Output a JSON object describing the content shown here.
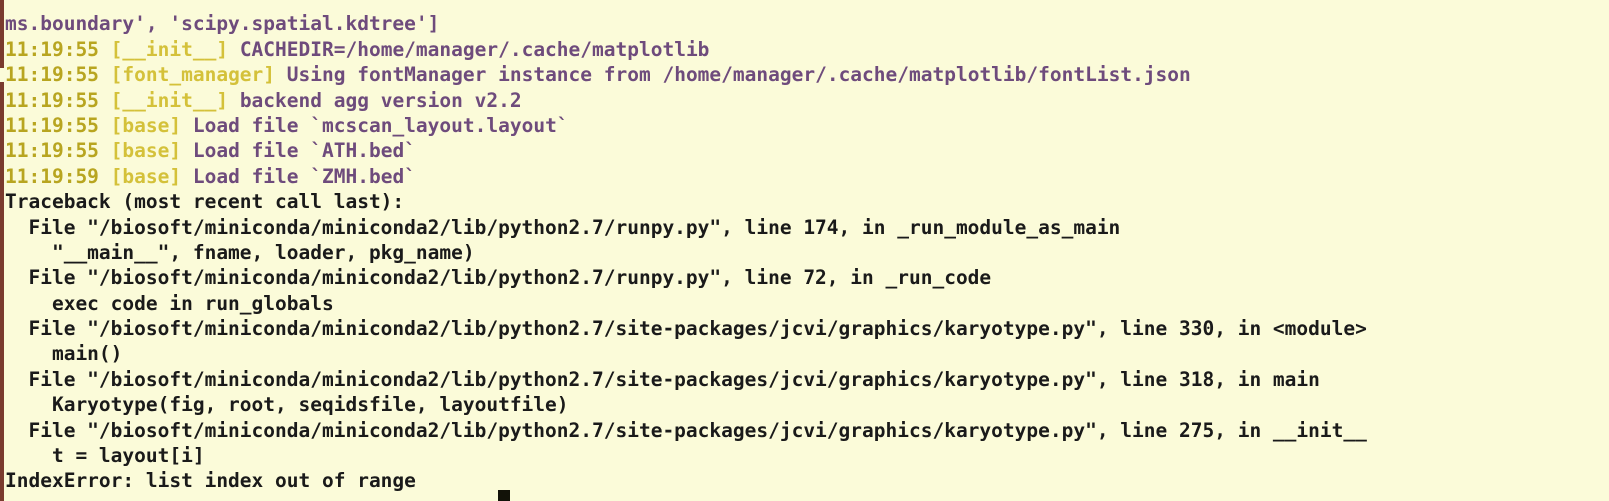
{
  "terminal": {
    "window_name": "python-traceback-terminal",
    "colors": {
      "background": "#fbfbd9",
      "timestamp": "#b8a520",
      "module": "#d4c13a",
      "message": "#6e4b7c",
      "traceback": "#1a1a1a",
      "border": "#7a3b2e",
      "cursor": "#121208"
    },
    "clipped_top_line": "",
    "log_lines": [
      {
        "type": "continuation",
        "message": "ms.boundary', 'scipy.spatial.kdtree']"
      },
      {
        "type": "log",
        "timestamp": "11:19:55",
        "module": "[__init__]",
        "message": "CACHEDIR=/home/manager/.cache/matplotlib"
      },
      {
        "type": "log",
        "timestamp": "11:19:55",
        "module": "[font_manager]",
        "message": "Using fontManager instance from /home/manager/.cache/matplotlib/fontList.json"
      },
      {
        "type": "log",
        "timestamp": "11:19:55",
        "module": "[__init__]",
        "message": "backend agg version v2.2"
      },
      {
        "type": "log",
        "timestamp": "11:19:55",
        "module": "[base]",
        "message": "Load file `mcscan_layout.layout`"
      },
      {
        "type": "log",
        "timestamp": "11:19:55",
        "module": "[base]",
        "message": "Load file `ATH.bed`"
      },
      {
        "type": "log",
        "timestamp": "11:19:59",
        "module": "[base]",
        "message": "Load file `ZMH.bed`"
      }
    ],
    "traceback_lines": [
      "Traceback (most recent call last):",
      "  File \"/biosoft/miniconda/miniconda2/lib/python2.7/runpy.py\", line 174, in _run_module_as_main",
      "    \"__main__\", fname, loader, pkg_name)",
      "  File \"/biosoft/miniconda/miniconda2/lib/python2.7/runpy.py\", line 72, in _run_code",
      "    exec code in run_globals",
      "  File \"/biosoft/miniconda/miniconda2/lib/python2.7/site-packages/jcvi/graphics/karyotype.py\", line 330, in <module>",
      "    main()",
      "  File \"/biosoft/miniconda/miniconda2/lib/python2.7/site-packages/jcvi/graphics/karyotype.py\", line 318, in main",
      "    Karyotype(fig, root, seqidsfile, layoutfile)",
      "  File \"/biosoft/miniconda/miniconda2/lib/python2.7/site-packages/jcvi/graphics/karyotype.py\", line 275, in __init__",
      "    t = layout[i]",
      "IndexError: list index out of range"
    ]
  }
}
